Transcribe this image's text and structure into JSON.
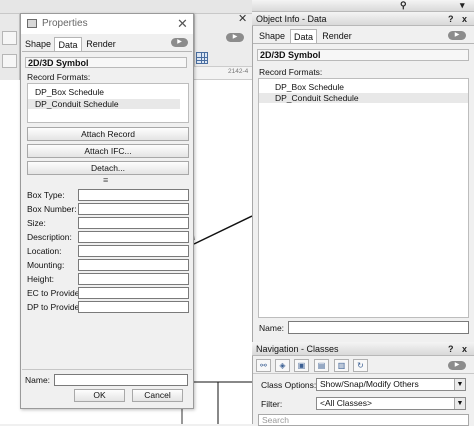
{
  "properties_dialog": {
    "title": "Properties",
    "tabs": [
      "Shape",
      "Data",
      "Render"
    ],
    "object_type": "2D/3D Symbol",
    "record_formats_label": "Record Formats:",
    "record_formats": [
      "DP_Box Schedule",
      "DP_Conduit Schedule"
    ],
    "buttons": {
      "attach_record": "Attach Record",
      "attach_ifc": "Attach IFC...",
      "detach": "Detach..."
    },
    "fields": [
      {
        "label": "Box Type:",
        "value": ""
      },
      {
        "label": "Box Number:",
        "value": ""
      },
      {
        "label": "Size:",
        "value": ""
      },
      {
        "label": "Description:",
        "value": ""
      },
      {
        "label": "Location:",
        "value": ""
      },
      {
        "label": "Mounting:",
        "value": ""
      },
      {
        "label": "Height:",
        "value": ""
      },
      {
        "label": "EC to Provide:",
        "value": ""
      },
      {
        "label": "DP to Provide:",
        "value": ""
      }
    ],
    "name_label": "Name:",
    "name_value": "",
    "ok_label": "OK",
    "cancel_label": "Cancel"
  },
  "object_info": {
    "title": "Object Info - Data",
    "help": "?",
    "close": "x",
    "tabs": [
      "Shape",
      "Data",
      "Render"
    ],
    "object_type": "2D/3D Symbol",
    "record_formats_label": "Record Formats:",
    "record_formats": [
      "DP_Box Schedule",
      "DP_Conduit Schedule"
    ],
    "name_label": "Name:",
    "name_value": ""
  },
  "navigation": {
    "title": "Navigation - Classes",
    "help": "?",
    "close": "x",
    "class_options_label": "Class Options:",
    "class_options_value": "Show/Snap/Modify Others",
    "filter_label": "Filter:",
    "filter_value": "<All Classes>",
    "search_placeholder": "Search"
  },
  "background": {
    "sheet_label": "2142-4"
  },
  "colors": {
    "panel_bg": "#f0f0f0",
    "selected_row": "#e8e8e8",
    "title_gradient_top": "#f4f4f4",
    "title_gradient_bottom": "#d9d9d9"
  }
}
